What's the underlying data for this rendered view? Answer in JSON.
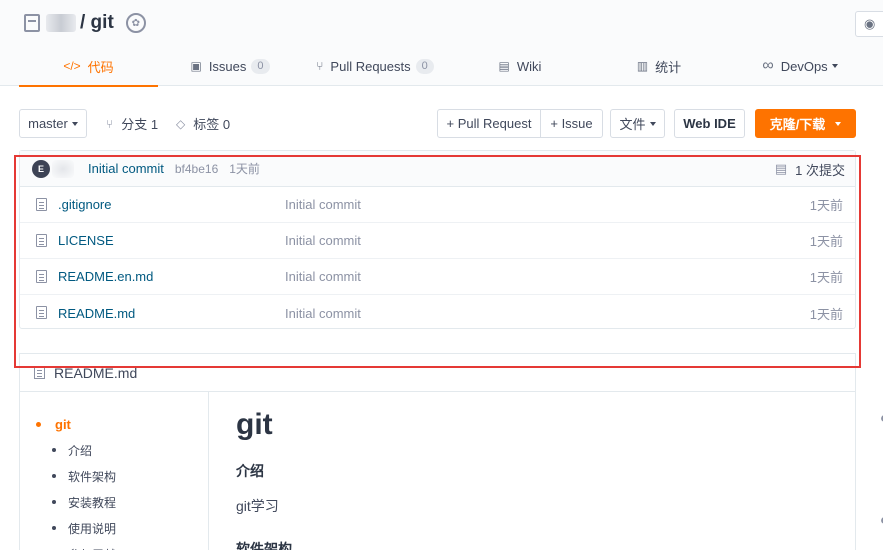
{
  "header": {
    "repo_path": "/ git",
    "watch_icon": "eye-icon"
  },
  "tabs": [
    {
      "label": "代码",
      "icon": "code"
    },
    {
      "label": "Issues",
      "count": "0",
      "icon": "issues"
    },
    {
      "label": "Pull Requests",
      "count": "0",
      "icon": "pull-request"
    },
    {
      "label": "Wiki",
      "icon": "wiki"
    },
    {
      "label": "统计",
      "icon": "stats"
    },
    {
      "label": "DevOps",
      "icon": "infinity"
    }
  ],
  "toolbar": {
    "branch": "master",
    "branches": "分支 1",
    "tags": "标签 0",
    "pull_request": "+ Pull Request",
    "issue": "+ Issue",
    "file": "文件",
    "web_ide": "Web IDE",
    "clone": "克隆/下载"
  },
  "commit": {
    "avatar_letter": "E",
    "message": "Initial commit",
    "hash": "bf4be16",
    "time": "1天前",
    "count": "1 次提交"
  },
  "files": [
    {
      "name": ".gitignore",
      "commit": "Initial commit",
      "time": "1天前"
    },
    {
      "name": "LICENSE",
      "commit": "Initial commit",
      "time": "1天前"
    },
    {
      "name": "README.en.md",
      "commit": "Initial commit",
      "time": "1天前"
    },
    {
      "name": "README.md",
      "commit": "Initial commit",
      "time": "1天前"
    }
  ],
  "readme": {
    "filename": "README.md",
    "toc": [
      "git",
      "介绍",
      "软件架构",
      "安装教程",
      "使用说明",
      "参与贡献"
    ],
    "title": "git",
    "section1": "介绍",
    "intro": "git学习",
    "section2": "软件架构"
  },
  "colors": {
    "accent": "#fe7300",
    "link": "#005980",
    "highlight": "#e53935"
  }
}
